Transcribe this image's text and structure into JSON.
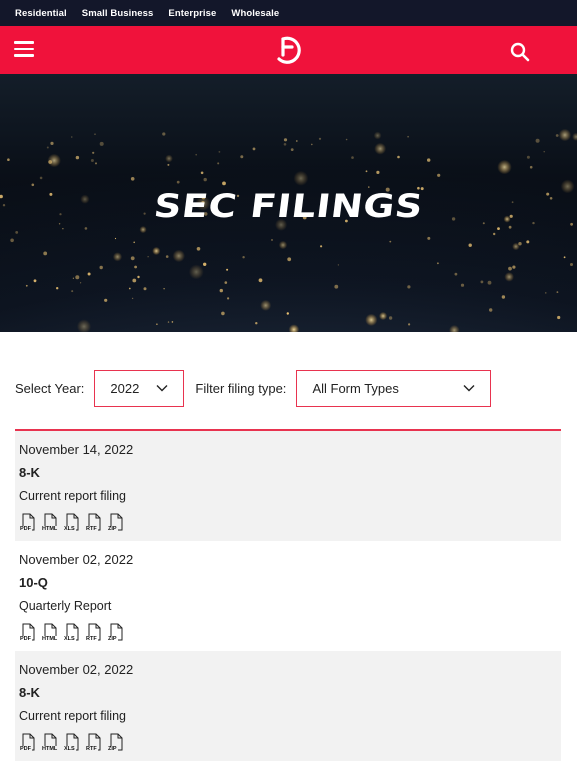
{
  "topnav": {
    "items": [
      "Residential",
      "Small Business",
      "Enterprise",
      "Wholesale"
    ]
  },
  "header": {
    "menu_icon": "hamburger-menu-icon",
    "logo_icon": "frontier-logo-icon",
    "search_icon": "search-icon"
  },
  "hero": {
    "title": "SEC FILINGS"
  },
  "filters": {
    "year_label": "Select Year:",
    "year_value": "2022",
    "type_label": "Filter filing type:",
    "type_value": "All Form Types"
  },
  "filings": [
    {
      "date": "November 14, 2022",
      "form": "8-K",
      "description": "Current report filing",
      "formats": [
        "PDF",
        "HTML",
        "XLS",
        "RTF",
        "ZIP"
      ]
    },
    {
      "date": "November 02, 2022",
      "form": "10-Q",
      "description": "Quarterly Report",
      "formats": [
        "PDF",
        "HTML",
        "XLS",
        "RTF",
        "ZIP"
      ]
    },
    {
      "date": "November 02, 2022",
      "form": "8-K",
      "description": "Current report filing",
      "formats": [
        "PDF",
        "HTML",
        "XLS",
        "RTF",
        "ZIP"
      ]
    }
  ],
  "colors": {
    "brand_red": "#f0123b",
    "topbar_navy": "#13172a",
    "accent_border": "#e8334f",
    "row_shade": "#f2f2f2"
  }
}
